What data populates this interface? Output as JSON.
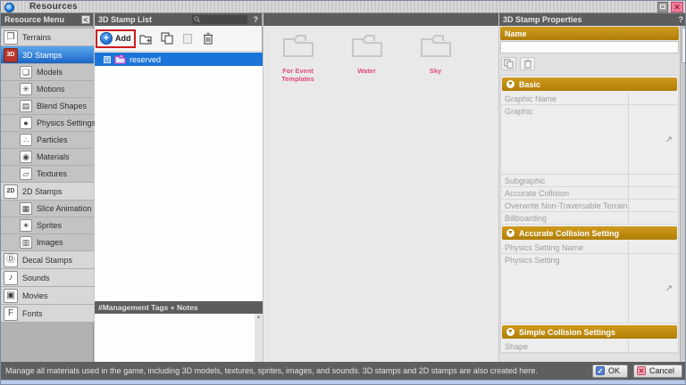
{
  "window": {
    "title": "Resources"
  },
  "colors": {
    "gold": "#c18c12",
    "accent_blue": "#1b74d9",
    "pink_label": "#e34b7d",
    "magenta_folder": "#d943cf",
    "header_gray": "#5d5d5d",
    "highlight_red": "#cf1c1c",
    "ok_blue": "#5b7fd0",
    "cancel_pink": "#f3a7b6"
  },
  "sidebar": {
    "header": "Resource Menu",
    "collapse_label": "<",
    "items": [
      {
        "label": "Terrains",
        "icon": "terrains-icon",
        "level": 0,
        "selected": false
      },
      {
        "label": "3D Stamps",
        "icon": "3d-stamps-icon",
        "level": 0,
        "selected": true
      },
      {
        "label": "Models",
        "icon": "models-icon",
        "level": 1,
        "selected": false
      },
      {
        "label": "Motions",
        "icon": "motions-icon",
        "level": 1,
        "selected": false
      },
      {
        "label": "Blend Shapes",
        "icon": "blend-shapes-icon",
        "level": 1,
        "selected": false
      },
      {
        "label": "Physics Settings",
        "icon": "physics-settings-icon",
        "level": 1,
        "selected": false
      },
      {
        "label": "Particles",
        "icon": "particles-icon",
        "level": 1,
        "selected": false
      },
      {
        "label": "Materials",
        "icon": "materials-icon",
        "level": 1,
        "selected": false
      },
      {
        "label": "Textures",
        "icon": "textures-icon",
        "level": 1,
        "selected": false
      },
      {
        "label": "2D Stamps",
        "icon": "2d-stamps-icon",
        "level": 0,
        "selected": false
      },
      {
        "label": "Slice Animation",
        "icon": "slice-animation-icon",
        "level": 1,
        "selected": false
      },
      {
        "label": "Sprites",
        "icon": "sprites-icon",
        "level": 1,
        "selected": false
      },
      {
        "label": "Images",
        "icon": "images-icon",
        "level": 1,
        "selected": false
      },
      {
        "label": "Decal Stamps",
        "icon": "decal-stamps-icon",
        "level": 0,
        "selected": false
      },
      {
        "label": "Sounds",
        "icon": "sounds-icon",
        "level": 0,
        "selected": false
      },
      {
        "label": "Movies",
        "icon": "movies-icon",
        "level": 0,
        "selected": false
      },
      {
        "label": "Fonts",
        "icon": "fonts-icon",
        "level": 0,
        "selected": false
      }
    ]
  },
  "stamp_list": {
    "header": "3D Stamp List",
    "help_label": "?",
    "add_label": "Add",
    "toolbar_icons": [
      "add-icon",
      "new-folder-icon",
      "duplicate-icon",
      "paste-icon",
      "trash-icon"
    ],
    "tree": [
      {
        "label": "reserved",
        "selected": true,
        "expandable": true
      }
    ],
    "tags_header": "#Management Tags + Notes",
    "notes_value": ""
  },
  "content": {
    "folders": [
      {
        "label": "For Event Templates"
      },
      {
        "label": "Water"
      },
      {
        "label": "Sky"
      }
    ]
  },
  "properties": {
    "header": "3D Stamp Properties",
    "help_label": "?",
    "name_section": "Name",
    "name_value": "",
    "toolbar_icons": [
      "duplicate-icon",
      "trash-icon"
    ],
    "sections": [
      {
        "title": "Basic",
        "rows": [
          {
            "label": "Graphic Name",
            "value": "",
            "tall": false,
            "arrow": false
          },
          {
            "label": "Graphic",
            "value": "",
            "tall": true,
            "arrow": true
          },
          {
            "label": "Subgraphic",
            "value": "",
            "tall": false,
            "arrow": false
          },
          {
            "label": "Accurate Collision",
            "value": "",
            "tall": false,
            "arrow": false
          },
          {
            "label": "Overwrite Non-Traversable Terrain",
            "value": "",
            "tall": false,
            "arrow": false
          },
          {
            "label": "Billboarding",
            "value": "",
            "tall": false,
            "arrow": false
          }
        ]
      },
      {
        "title": "Accurate Collision Setting",
        "rows": [
          {
            "label": "Physics Setting Name",
            "value": "",
            "tall": false,
            "arrow": false
          },
          {
            "label": "Physics Setting",
            "value": "",
            "tall": true,
            "arrow": true
          }
        ]
      },
      {
        "title": "Simple Collision Settings",
        "rows": [
          {
            "label": "Shape",
            "value": "",
            "tall": false,
            "arrow": false
          }
        ]
      }
    ]
  },
  "statusbar": {
    "text": "Manage all materials used in the game, including 3D models, textures, sprites, images, and sounds. 3D stamps and 2D stamps are also created here.",
    "ok_label": "OK",
    "cancel_label": "Cancel"
  }
}
